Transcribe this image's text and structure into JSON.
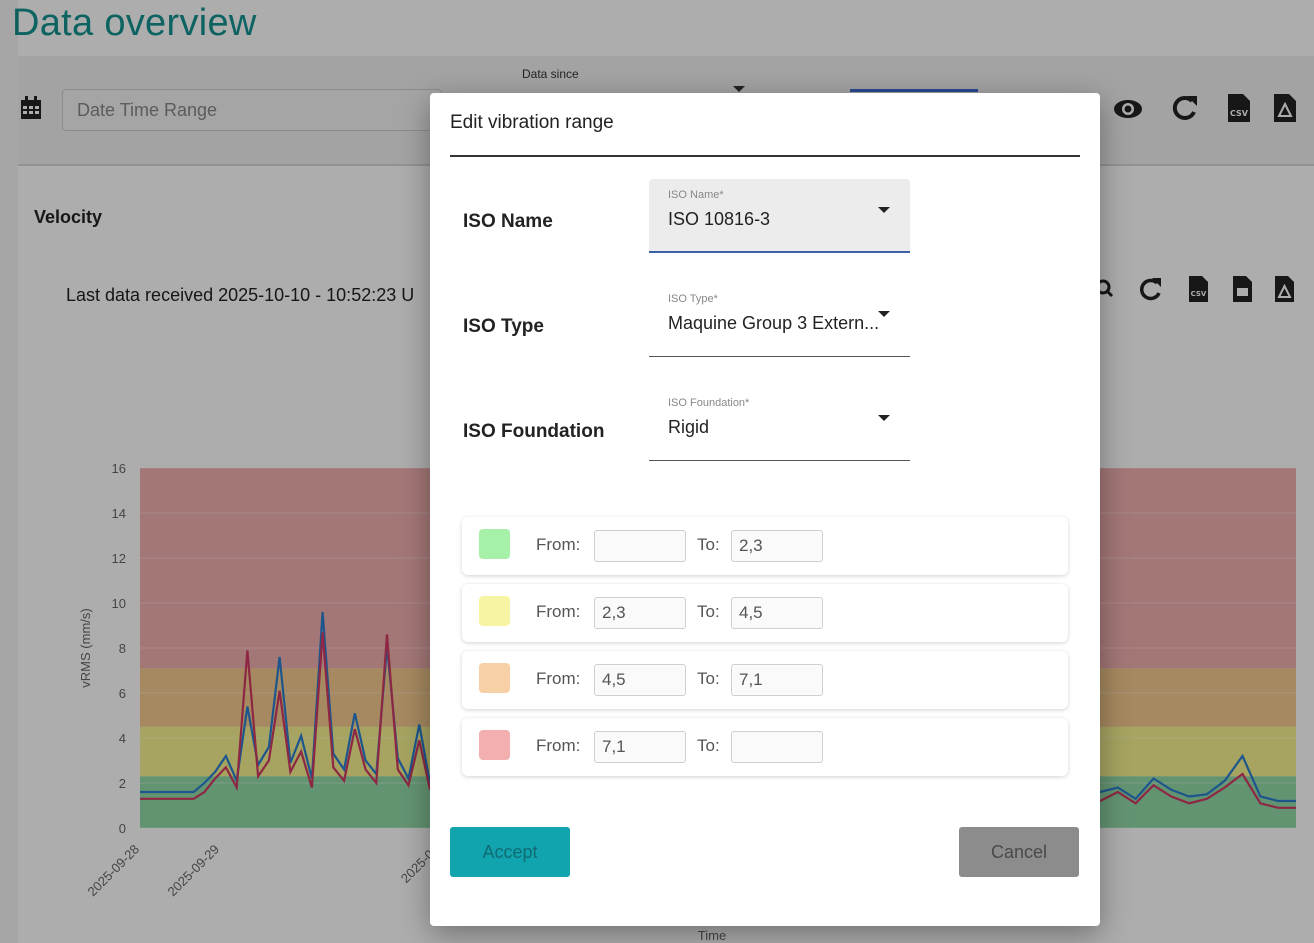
{
  "page": {
    "title": "Data overview",
    "date_range_placeholder": "Date Time Range",
    "data_since_label": "Data since"
  },
  "velocity": {
    "title": "Velocity",
    "last_data": "Last data received 2025-10-10 - 10:52:23 U"
  },
  "chart_data": {
    "type": "line",
    "ylabel": "vRMS (mm/s)",
    "xlabel": "Time",
    "ylim": [
      0,
      16
    ],
    "y_ticks": [
      "0",
      "2",
      "4",
      "6",
      "8",
      "10",
      "12",
      "14",
      "16"
    ],
    "x_ticks": [
      "2025-09-28",
      "2025-09-29",
      "2025-09"
    ],
    "bands": [
      {
        "from": 0,
        "to": 2.3,
        "color": "#7fd39a"
      },
      {
        "from": 2.3,
        "to": 4.5,
        "color": "#f3f07a"
      },
      {
        "from": 4.5,
        "to": 7.1,
        "color": "#f3c27a"
      },
      {
        "from": 7.1,
        "to": 16,
        "color": "#f0a2a2"
      }
    ],
    "series": [
      {
        "color": "#2a7fd0",
        "values": [
          1.6,
          1.6,
          1.6,
          1.6,
          1.6,
          1.6,
          2.0,
          2.5,
          3.2,
          2.1,
          5.4,
          2.8,
          3.6,
          7.6,
          2.9,
          4.1,
          2.2,
          9.6,
          3.3,
          2.6,
          5.1,
          3.0,
          2.4,
          8.1,
          3.1,
          2.2,
          4.6,
          2.0
        ]
      },
      {
        "color": "#d03a63",
        "values": [
          1.3,
          1.3,
          1.3,
          1.3,
          1.3,
          1.3,
          1.6,
          2.2,
          2.7,
          1.8,
          7.9,
          2.3,
          3.0,
          6.1,
          2.5,
          3.4,
          1.8,
          8.7,
          2.7,
          2.1,
          4.4,
          2.6,
          2.0,
          8.6,
          2.6,
          1.9,
          3.9,
          1.7
        ]
      },
      {
        "color": "#2a7fd0",
        "values": [
          1.6,
          1.8,
          1.3,
          2.2,
          1.7,
          1.4,
          1.5,
          2.1,
          3.2,
          1.4,
          1.2,
          1.2
        ]
      },
      {
        "color": "#d03a63",
        "values": [
          1.2,
          1.6,
          1.1,
          1.9,
          1.4,
          1.1,
          1.3,
          1.8,
          2.4,
          1.1,
          0.9,
          0.9
        ]
      }
    ]
  },
  "dialog": {
    "title": "Edit vibration range",
    "iso_name": {
      "label": "ISO Name",
      "float_label": "ISO Name*",
      "value": "ISO 10816-3"
    },
    "iso_type": {
      "label": "ISO Type",
      "float_label": "ISO Type*",
      "value": "Maquine Group 3 Extern..."
    },
    "iso_foundation": {
      "label": "ISO Foundation",
      "float_label": "ISO Foundation*",
      "value": "Rigid"
    },
    "from_label": "From:",
    "to_label": "To:",
    "ranges": [
      {
        "color": "#a6f0a8",
        "from": "",
        "to": "2,3"
      },
      {
        "color": "#f7f5a4",
        "from": "2,3",
        "to": "4,5"
      },
      {
        "color": "#f7d1a5",
        "from": "4,5",
        "to": "7,1"
      },
      {
        "color": "#f3aeb0",
        "from": "7,1",
        "to": ""
      }
    ],
    "accept_label": "Accept",
    "cancel_label": "Cancel"
  }
}
